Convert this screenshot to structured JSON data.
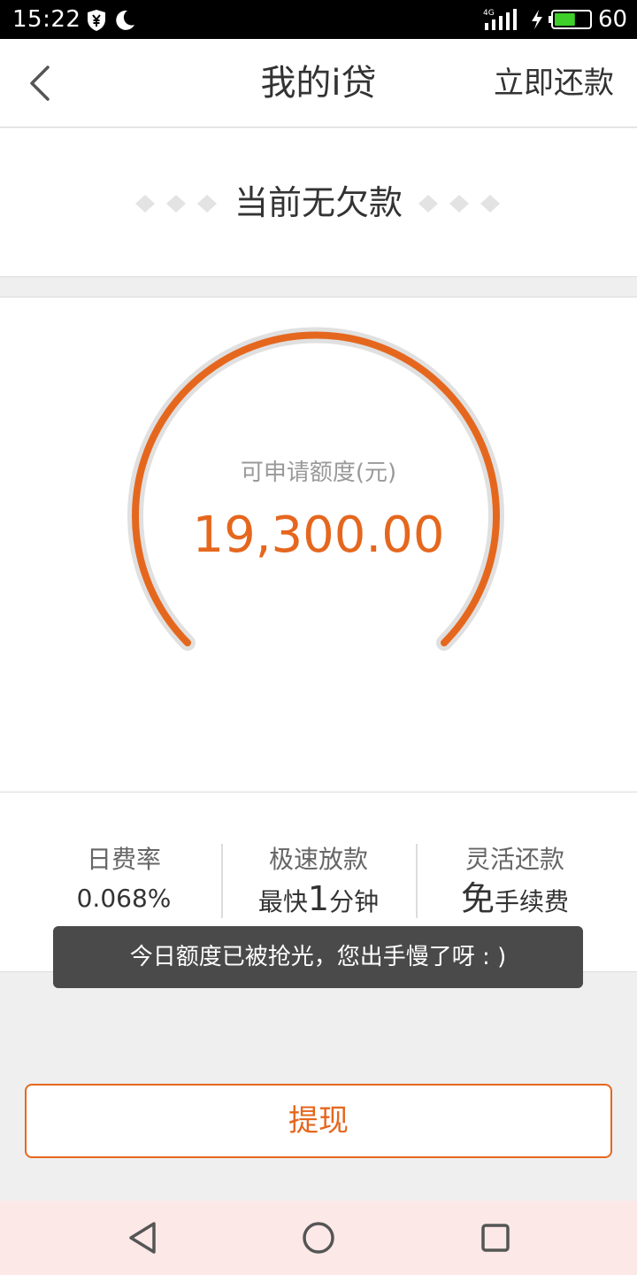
{
  "status_bar": {
    "time": "15:22",
    "network": "4G",
    "battery_level": "60",
    "battery_fraction": 0.6,
    "icons": [
      "yuan-shield-icon",
      "moon-icon",
      "signal-icon",
      "charging-bolt-icon",
      "battery-icon"
    ]
  },
  "nav": {
    "back_icon": "chevron-left-icon",
    "title": "我的i贷",
    "action": "立即还款"
  },
  "debt_status": {
    "text": "当前无欠款"
  },
  "gauge": {
    "label": "可申请额度(元)",
    "amount": "19,300.00"
  },
  "features": [
    {
      "title": "日费率",
      "value": "0.068%"
    },
    {
      "title": "极速放款",
      "value_prefix": "最快",
      "value_emph": "1",
      "value_suffix": "分钟"
    },
    {
      "title": "灵活还款",
      "value_emph": "免",
      "value_suffix": "手续费"
    }
  ],
  "toast": {
    "text": "今日额度已被抢光，您出手慢了呀 : )"
  },
  "withdraw_button": {
    "label": "提现"
  },
  "system_nav": {
    "icons": [
      "back-triangle-icon",
      "home-circle-icon",
      "recents-square-icon"
    ]
  },
  "colors": {
    "accent": "#e5671e",
    "gauge_track": "#e0e0e0",
    "toast_bg": "#4a4a4a",
    "nav_bar_bg": "#fde8e8",
    "battery_fill": "#3ecf2a"
  }
}
